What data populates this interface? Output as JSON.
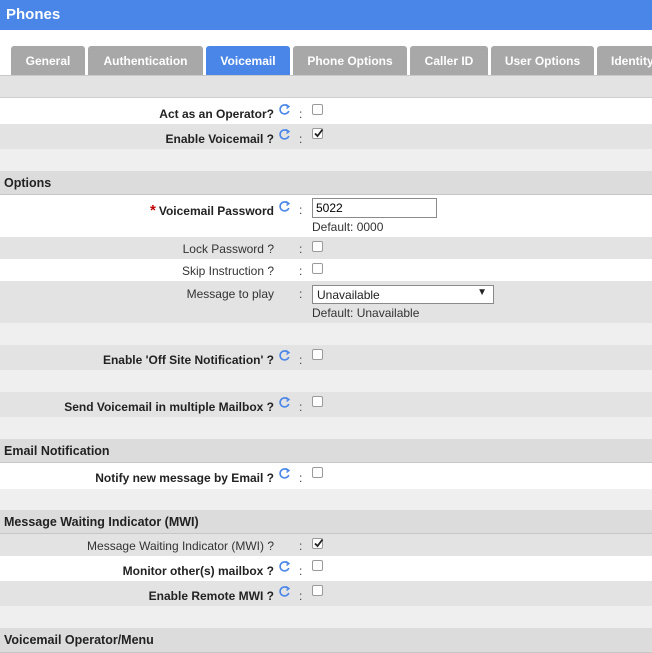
{
  "header": {
    "title": "Phones"
  },
  "tabs": [
    {
      "label": "General"
    },
    {
      "label": "Authentication"
    },
    {
      "label": "Voicemail",
      "active": true
    },
    {
      "label": "Phone Options"
    },
    {
      "label": "Caller ID"
    },
    {
      "label": "User Options"
    },
    {
      "label": "Identity"
    }
  ],
  "fields": {
    "act_as_operator": {
      "label": "Act as an Operator?",
      "checked": false
    },
    "enable_voicemail": {
      "label": "Enable Voicemail ?",
      "checked": true
    },
    "voicemail_password": {
      "label": "Voicemail Password",
      "value": "5022",
      "default": "Default: 0000"
    },
    "lock_password": {
      "label": "Lock Password ?",
      "checked": false
    },
    "skip_instruction": {
      "label": "Skip Instruction ?",
      "checked": false
    },
    "message_to_play": {
      "label": "Message to play",
      "value": "Unavailable",
      "default": "Default: Unavailable"
    },
    "off_site_notification": {
      "label": "Enable 'Off Site Notification' ?",
      "checked": false
    },
    "multiple_mailbox": {
      "label": "Send Voicemail in multiple Mailbox ?",
      "checked": false
    },
    "notify_email": {
      "label": "Notify new message by Email ?",
      "checked": false
    },
    "mwi": {
      "label": "Message Waiting Indicator (MWI) ?",
      "checked": true
    },
    "monitor_mailbox": {
      "label": "Monitor other(s) mailbox ?",
      "checked": false
    },
    "remote_mwi": {
      "label": "Enable Remote MWI ?",
      "checked": false
    }
  },
  "sections": {
    "options": "Options",
    "email": "Email Notification",
    "mwi": "Message Waiting Indicator (MWI)",
    "operator_menu": "Voicemail Operator/Menu"
  },
  "colon": ":",
  "required_mark": "*",
  "icons": {
    "help": "refresh-help-icon",
    "checkmark": "checkmark-icon",
    "dropdown": "triangle-down-icon"
  },
  "colors": {
    "accent": "#4a86e8",
    "tab_inactive": "#a8a8a8",
    "required": "#c00000"
  }
}
